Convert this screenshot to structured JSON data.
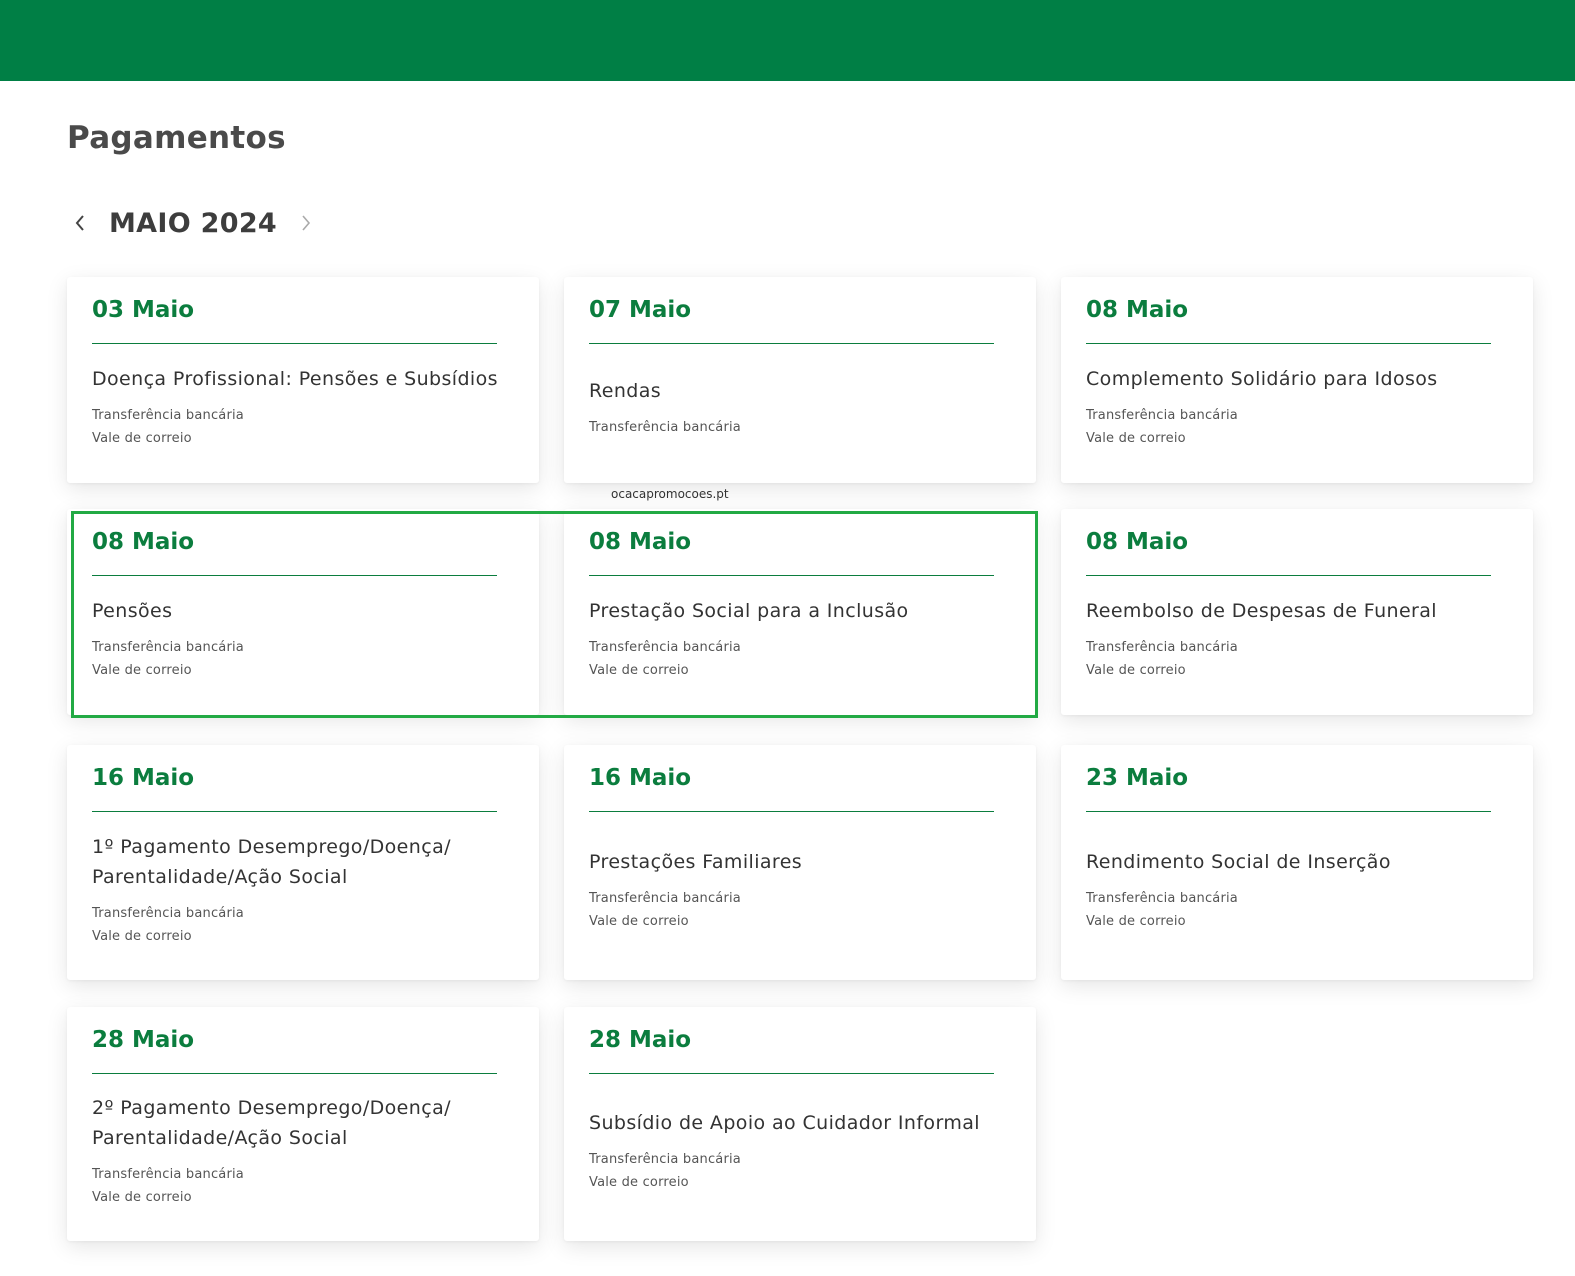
{
  "page": {
    "title": "Pagamentos"
  },
  "nav": {
    "month": "MAIO 2024",
    "prev_icon": "chevron-left-icon",
    "next_icon": "chevron-right-icon"
  },
  "watermark": "ocacapromocoes.pt",
  "colors": {
    "brand_green": "#007f45",
    "date_green": "#0b7d3e",
    "highlight_border": "#22aa44"
  },
  "cards": [
    {
      "date": "03 Maio",
      "name": "Doença Profissional: Pensões e Subsídios",
      "methods": [
        "Transferência bancária",
        "Vale de correio"
      ]
    },
    {
      "date": "07 Maio",
      "name": "Rendas",
      "methods": [
        "Transferência bancária"
      ]
    },
    {
      "date": "08 Maio",
      "name": "Complemento Solidário para Idosos",
      "methods": [
        "Transferência bancária",
        "Vale de correio"
      ]
    },
    {
      "date": "08 Maio",
      "name": "Pensões",
      "methods": [
        "Transferência bancária",
        "Vale de correio"
      ]
    },
    {
      "date": "08 Maio",
      "name": "Prestação Social para a Inclusão",
      "methods": [
        "Transferência bancária",
        "Vale de correio"
      ]
    },
    {
      "date": "08 Maio",
      "name": "Reembolso de Despesas de Funeral",
      "methods": [
        "Transferência bancária",
        "Vale de correio"
      ]
    },
    {
      "date": "16 Maio",
      "name": "1º Pagamento Desemprego/Doença/ Parentalidade/Ação Social",
      "methods": [
        "Transferência bancária",
        "Vale de correio"
      ]
    },
    {
      "date": "16 Maio",
      "name": "Prestações Familiares",
      "methods": [
        "Transferência bancária",
        "Vale de correio"
      ]
    },
    {
      "date": "23 Maio",
      "name": "Rendimento Social de Inserção",
      "methods": [
        "Transferência bancária",
        "Vale de correio"
      ]
    },
    {
      "date": "28 Maio",
      "name": "2º Pagamento Desemprego/Doença/ Parentalidade/Ação Social",
      "methods": [
        "Transferência bancária",
        "Vale de correio"
      ]
    },
    {
      "date": "28 Maio",
      "name": "Subsídio de Apoio ao Cuidador Informal",
      "methods": [
        "Transferência bancária",
        "Vale de correio"
      ]
    }
  ]
}
